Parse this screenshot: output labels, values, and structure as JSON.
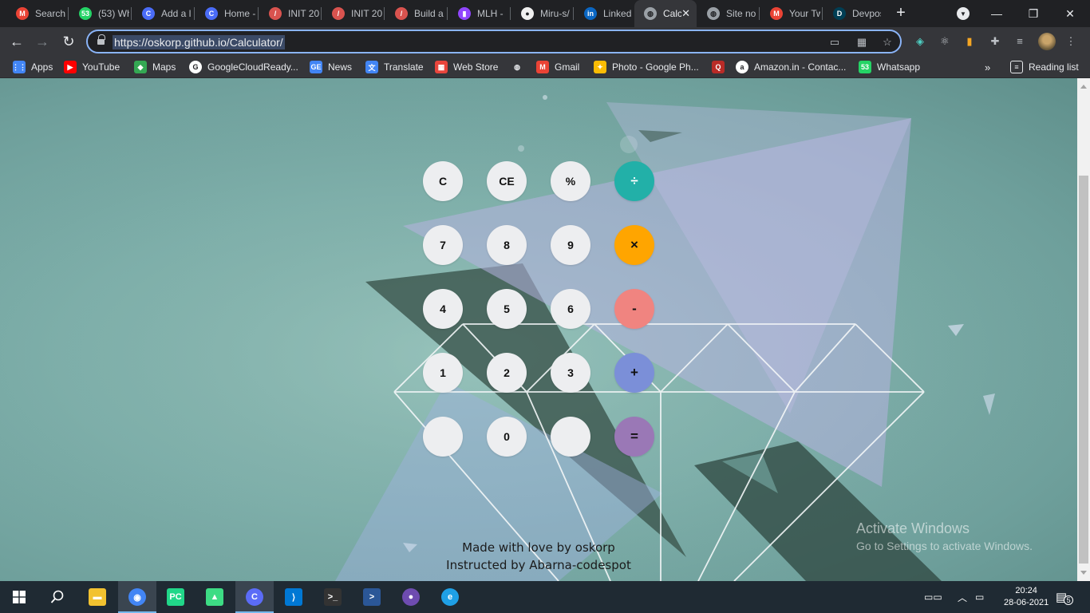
{
  "browser": {
    "tabs": [
      {
        "label": "Search",
        "icon": "gmail-icon",
        "color": "#ea4335",
        "glyph": "M"
      },
      {
        "label": "(53) Wh",
        "icon": "whatsapp-icon",
        "color": "#25d366",
        "glyph": "53"
      },
      {
        "label": "Add a l",
        "icon": "codespot-icon",
        "color": "#4a6cf7",
        "glyph": "C"
      },
      {
        "label": "Home -",
        "icon": "codespot-icon",
        "color": "#4a6cf7",
        "glyph": "C"
      },
      {
        "label": "INIT 20",
        "icon": "init-icon",
        "color": "#d9534f",
        "glyph": "/"
      },
      {
        "label": "INIT 20",
        "icon": "init-icon",
        "color": "#d9534f",
        "glyph": "/"
      },
      {
        "label": "Build a",
        "icon": "init-icon",
        "color": "#d9534f",
        "glyph": "/"
      },
      {
        "label": "MLH -",
        "icon": "twitch-icon",
        "color": "#9146ff",
        "glyph": "▮"
      },
      {
        "label": "Miru-s/",
        "icon": "github-icon",
        "color": "#f0f0f0",
        "glyph": "●"
      },
      {
        "label": "LinkedI",
        "icon": "linkedin-icon",
        "color": "#0a66c2",
        "glyph": "in"
      },
      {
        "label": "Calc",
        "icon": "globe-icon",
        "color": "#9aa0a6",
        "glyph": "◍"
      },
      {
        "label": "Site no",
        "icon": "globe-icon",
        "color": "#9aa0a6",
        "glyph": "◍"
      },
      {
        "label": "Your Tw",
        "icon": "gmail-icon",
        "color": "#ea4335",
        "glyph": "M"
      },
      {
        "label": "Devpos",
        "icon": "devpost-icon",
        "color": "#003e54",
        "glyph": "D"
      }
    ],
    "url": "https://oskorp.github.io/Calculator/",
    "bookmarks": [
      {
        "label": "Apps",
        "icon": "apps-grid-icon",
        "color": "#4285f4",
        "glyph": "⋮⋮"
      },
      {
        "label": "YouTube",
        "icon": "youtube-icon",
        "color": "#ff0000",
        "glyph": "▶"
      },
      {
        "label": "Maps",
        "icon": "maps-icon",
        "color": "#34a853",
        "glyph": "◆"
      },
      {
        "label": "GoogleCloudReady...",
        "icon": "google-icon",
        "color": "#ffffff",
        "glyph": "G"
      },
      {
        "label": "News",
        "icon": "google-news-icon",
        "color": "#4285f4",
        "glyph": "GE"
      },
      {
        "label": "Translate",
        "icon": "translate-icon",
        "color": "#4285f4",
        "glyph": "文"
      },
      {
        "label": "Web Store",
        "icon": "web-store-icon",
        "color": "#e8453c",
        "glyph": "▦"
      },
      {
        "label": "",
        "icon": "globe-icon",
        "color": "#e8eaed",
        "glyph": "◍"
      },
      {
        "label": "Gmail",
        "icon": "gmail-icon",
        "color": "#ea4335",
        "glyph": "M"
      },
      {
        "label": "Photo - Google Ph...",
        "icon": "google-photos-icon",
        "color": "#fbbc04",
        "glyph": "✦"
      },
      {
        "label": "",
        "icon": "quora-icon",
        "color": "#b92b27",
        "glyph": "Q"
      },
      {
        "label": "Amazon.in - Contac...",
        "icon": "amazon-icon",
        "color": "#ffffff",
        "glyph": "a"
      },
      {
        "label": "Whatsapp",
        "icon": "whatsapp-icon",
        "color": "#25d366",
        "glyph": "53"
      }
    ],
    "reading_list": "Reading list"
  },
  "calculator": {
    "keys": [
      {
        "label": "C",
        "color": "#edeef0",
        "fg": "#111111"
      },
      {
        "label": "CE",
        "color": "#edeef0",
        "fg": "#111111"
      },
      {
        "label": "%",
        "color": "#edeef0",
        "fg": "#111111"
      },
      {
        "label": "÷",
        "color": "#22b0a8",
        "fg": "#ffffff"
      },
      {
        "label": "7",
        "color": "#edeef0",
        "fg": "#111111"
      },
      {
        "label": "8",
        "color": "#edeef0",
        "fg": "#111111"
      },
      {
        "label": "9",
        "color": "#edeef0",
        "fg": "#111111"
      },
      {
        "label": "×",
        "color": "#ffa500",
        "fg": "#111111"
      },
      {
        "label": "4",
        "color": "#edeef0",
        "fg": "#111111"
      },
      {
        "label": "5",
        "color": "#edeef0",
        "fg": "#111111"
      },
      {
        "label": "6",
        "color": "#edeef0",
        "fg": "#111111"
      },
      {
        "label": "-",
        "color": "#f08480",
        "fg": "#111111"
      },
      {
        "label": "1",
        "color": "#edeef0",
        "fg": "#111111"
      },
      {
        "label": "2",
        "color": "#edeef0",
        "fg": "#111111"
      },
      {
        "label": "3",
        "color": "#edeef0",
        "fg": "#111111"
      },
      {
        "label": "+",
        "color": "#7b8fd8",
        "fg": "#111111"
      },
      {
        "label": "",
        "color": "#edeef0",
        "fg": "#111111"
      },
      {
        "label": "0",
        "color": "#edeef0",
        "fg": "#111111"
      },
      {
        "label": "",
        "color": "#edeef0",
        "fg": "#111111"
      },
      {
        "label": "=",
        "color": "#9a78b6",
        "fg": "#111111"
      }
    ],
    "footer_line1": "Made with love by oskorp",
    "footer_line2": "Instructed by Abarna-codespot"
  },
  "watermark": {
    "title": "Activate Windows",
    "subtitle": "Go to Settings to activate Windows."
  },
  "taskbar": {
    "apps": [
      {
        "name": "file-explorer-icon",
        "color": "#f2c230",
        "glyph": "▬"
      },
      {
        "name": "chrome-icon",
        "color": "#4285f4",
        "glyph": "◉",
        "active": true
      },
      {
        "name": "pycharm-icon",
        "color": "#21d789",
        "glyph": "PC"
      },
      {
        "name": "android-studio-icon",
        "color": "#3ddc84",
        "glyph": "▲"
      },
      {
        "name": "codespot-icon",
        "color": "#5b6cf7",
        "glyph": "C",
        "active": true
      },
      {
        "name": "vscode-icon",
        "color": "#0078d4",
        "glyph": "⟩"
      },
      {
        "name": "terminal-icon",
        "color": "#333333",
        "glyph": ">_"
      },
      {
        "name": "powershell-icon",
        "color": "#2b5797",
        "glyph": ">"
      },
      {
        "name": "obs-icon",
        "color": "#6e4cb0",
        "glyph": "●"
      },
      {
        "name": "edge-icon",
        "color": "#1fa0e6",
        "glyph": "e"
      }
    ],
    "time": "20:24",
    "date": "28-06-2021",
    "notifications": "5"
  }
}
